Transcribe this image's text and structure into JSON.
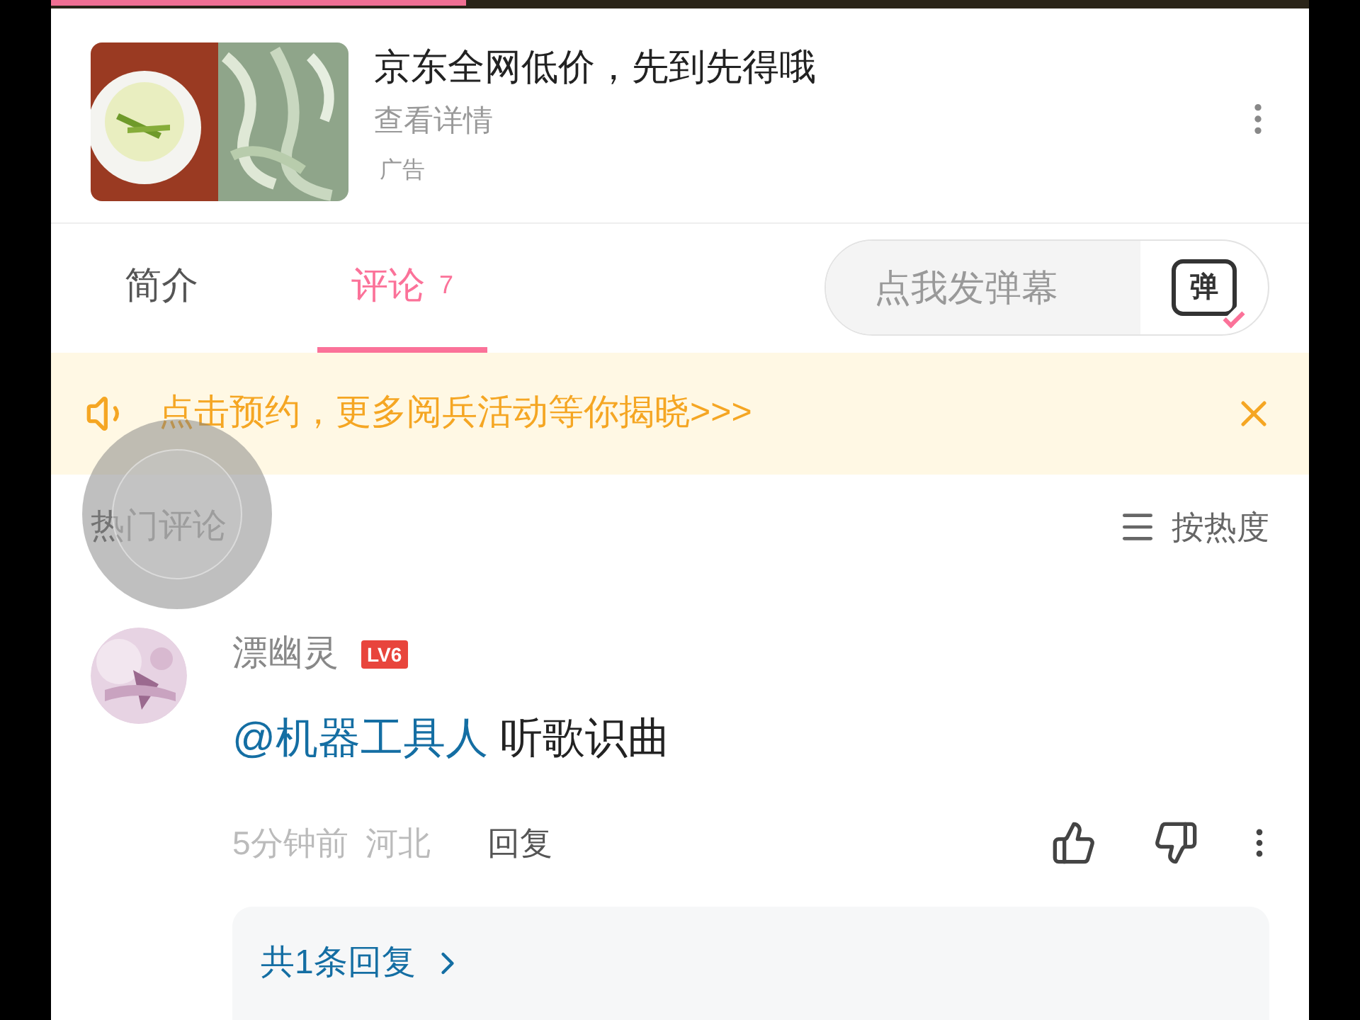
{
  "video_progress": {
    "level": 0.33
  },
  "ad": {
    "title": "京东全网低价，先到先得哦",
    "link": "查看详情",
    "label": "广告"
  },
  "tabs": [
    {
      "label": "简介",
      "selected": false
    },
    {
      "label": "评论",
      "count": "7",
      "selected": true
    }
  ],
  "danmaku_input": {
    "placeholder": "点我发弹幕",
    "icon_text": "弹"
  },
  "notice": {
    "text": "点击预约，更多阅兵活动等你揭晓>>>"
  },
  "comments_header": {
    "title": "热门评论",
    "sort": "按热度"
  },
  "comments": [
    {
      "user": "漂幽灵",
      "level": "LV6",
      "mention": "@机器工具人",
      "text": "听歌识曲",
      "time": "5分钟前",
      "location": "河北",
      "reply": "回复",
      "replies": "共1条回复"
    }
  ]
}
